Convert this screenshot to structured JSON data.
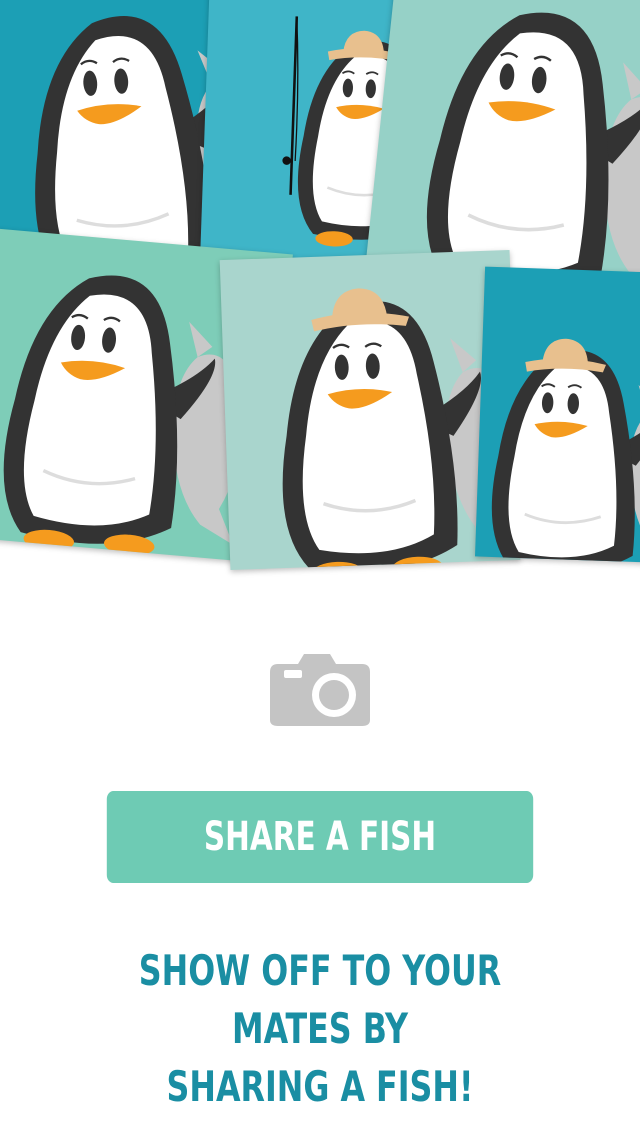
{
  "colors": {
    "teal_dark": "#1c9fb5",
    "teal_light": "#7ecdb8",
    "mint": "#a9d5cd",
    "button_bg": "#6ecbb4",
    "tagline_color": "#1a8ea3",
    "icon_grey": "#c4c4c4",
    "penguin_black": "#333333",
    "beak_orange": "#f59b1e",
    "hat_tan": "#e8c08e",
    "fish_grey": "#c8c8c8"
  },
  "collage": {
    "label": "penguin-photo-collage",
    "tiles": [
      {
        "name": "photo-penguin-fish-1",
        "bg": "#1c9fb5",
        "hat": false,
        "rod": false,
        "fish": true
      },
      {
        "name": "photo-penguin-rod",
        "bg": "#3fb5c8",
        "hat": true,
        "rod": true,
        "fish": false
      },
      {
        "name": "photo-penguin-fish-2",
        "bg": "#96d1c7",
        "hat": false,
        "rod": false,
        "fish": true
      },
      {
        "name": "photo-penguin-fish-3",
        "bg": "#7ecdb8",
        "hat": false,
        "rod": false,
        "fish": true
      },
      {
        "name": "photo-penguin-hat-fish",
        "bg": "#a9d5cd",
        "hat": true,
        "rod": false,
        "fish": true
      },
      {
        "name": "photo-penguin-hat-fish-2",
        "bg": "#1c9fb5",
        "hat": true,
        "rod": false,
        "fish": true
      }
    ]
  },
  "camera": {
    "icon": "camera-icon"
  },
  "share_button": {
    "label": "SHARE A FISH"
  },
  "tagline": {
    "line1": "SHOW OFF TO YOUR MATES BY",
    "line2": "SHARING A FISH!"
  }
}
